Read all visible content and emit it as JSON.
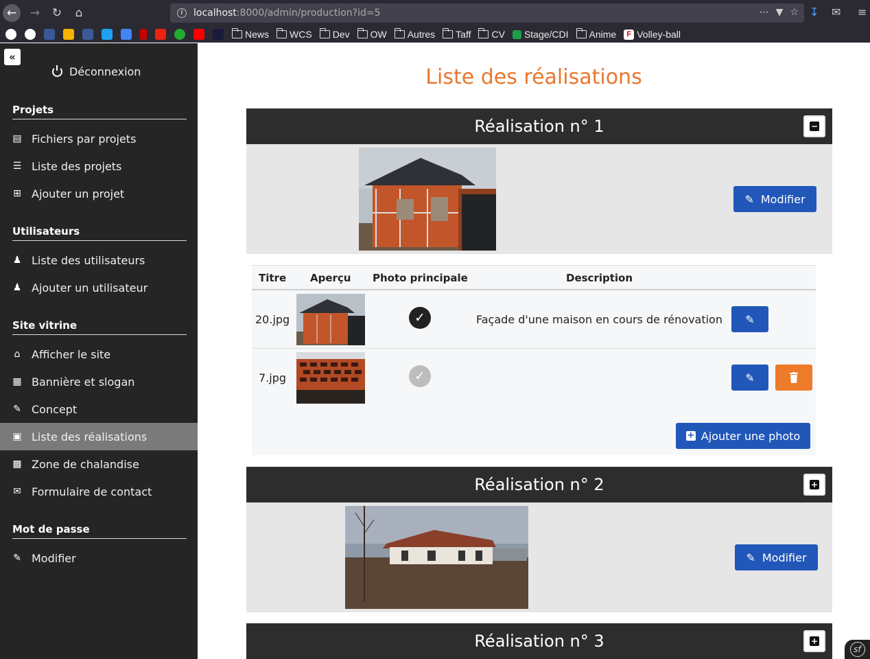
{
  "browser": {
    "url_host": "localhost",
    "url_rest": ":8000/admin/production?id=5",
    "bookmarks": [
      "News",
      "WCS",
      "Dev",
      "OW",
      "Autres",
      "Taff",
      "CV",
      "Stage/CDI",
      "Anime",
      "Volley-ball"
    ]
  },
  "sidebar": {
    "logout": "Déconnexion",
    "sections": [
      {
        "title": "Projets",
        "items": [
          "Fichiers par projets",
          "Liste des projets",
          "Ajouter un projet"
        ]
      },
      {
        "title": "Utilisateurs",
        "items": [
          "Liste des utilisateurs",
          "Ajouter un utilisateur"
        ]
      },
      {
        "title": "Site vitrine",
        "items": [
          "Afficher le site",
          "Bannière et slogan",
          "Concept",
          "Liste des réalisations",
          "Zone de chalandise",
          "Formulaire de contact"
        ]
      },
      {
        "title": "Mot de passe",
        "items": [
          "Modifier"
        ]
      }
    ],
    "active_item": "Liste des réalisations"
  },
  "main": {
    "title": "Liste des réalisations",
    "realisations": [
      {
        "title": "Réalisation n° 1",
        "expanded": true,
        "edit_label": "Modifier"
      },
      {
        "title": "Réalisation n° 2",
        "expanded": false,
        "edit_label": "Modifier"
      },
      {
        "title": "Réalisation n° 3",
        "expanded": false
      }
    ],
    "table": {
      "headers": [
        "Titre",
        "Aperçu",
        "Photo principale",
        "Description"
      ],
      "rows": [
        {
          "titre": "20.jpg",
          "principale": true,
          "description": "Façade d'une maison en cours de rénovation"
        },
        {
          "titre": "7.jpg",
          "principale": false,
          "description": ""
        }
      ],
      "add_photo_label": "Ajouter une photo"
    }
  },
  "colors": {
    "accent": "#e8772e",
    "primary": "#2157b8",
    "danger": "#ed7b2a",
    "sidebar": "#252525",
    "header": "#2d2d2d"
  }
}
